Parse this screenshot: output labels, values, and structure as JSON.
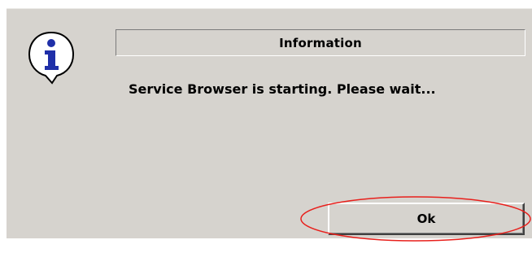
{
  "dialog": {
    "title": "Information",
    "message": "Service Browser is starting. Please wait...",
    "icon": "info-icon",
    "ok_label": "Ok"
  },
  "colors": {
    "dialog_background": "#d6d3ce",
    "icon_blue": "#1f2fa8",
    "highlight_red": "#e8201c"
  }
}
